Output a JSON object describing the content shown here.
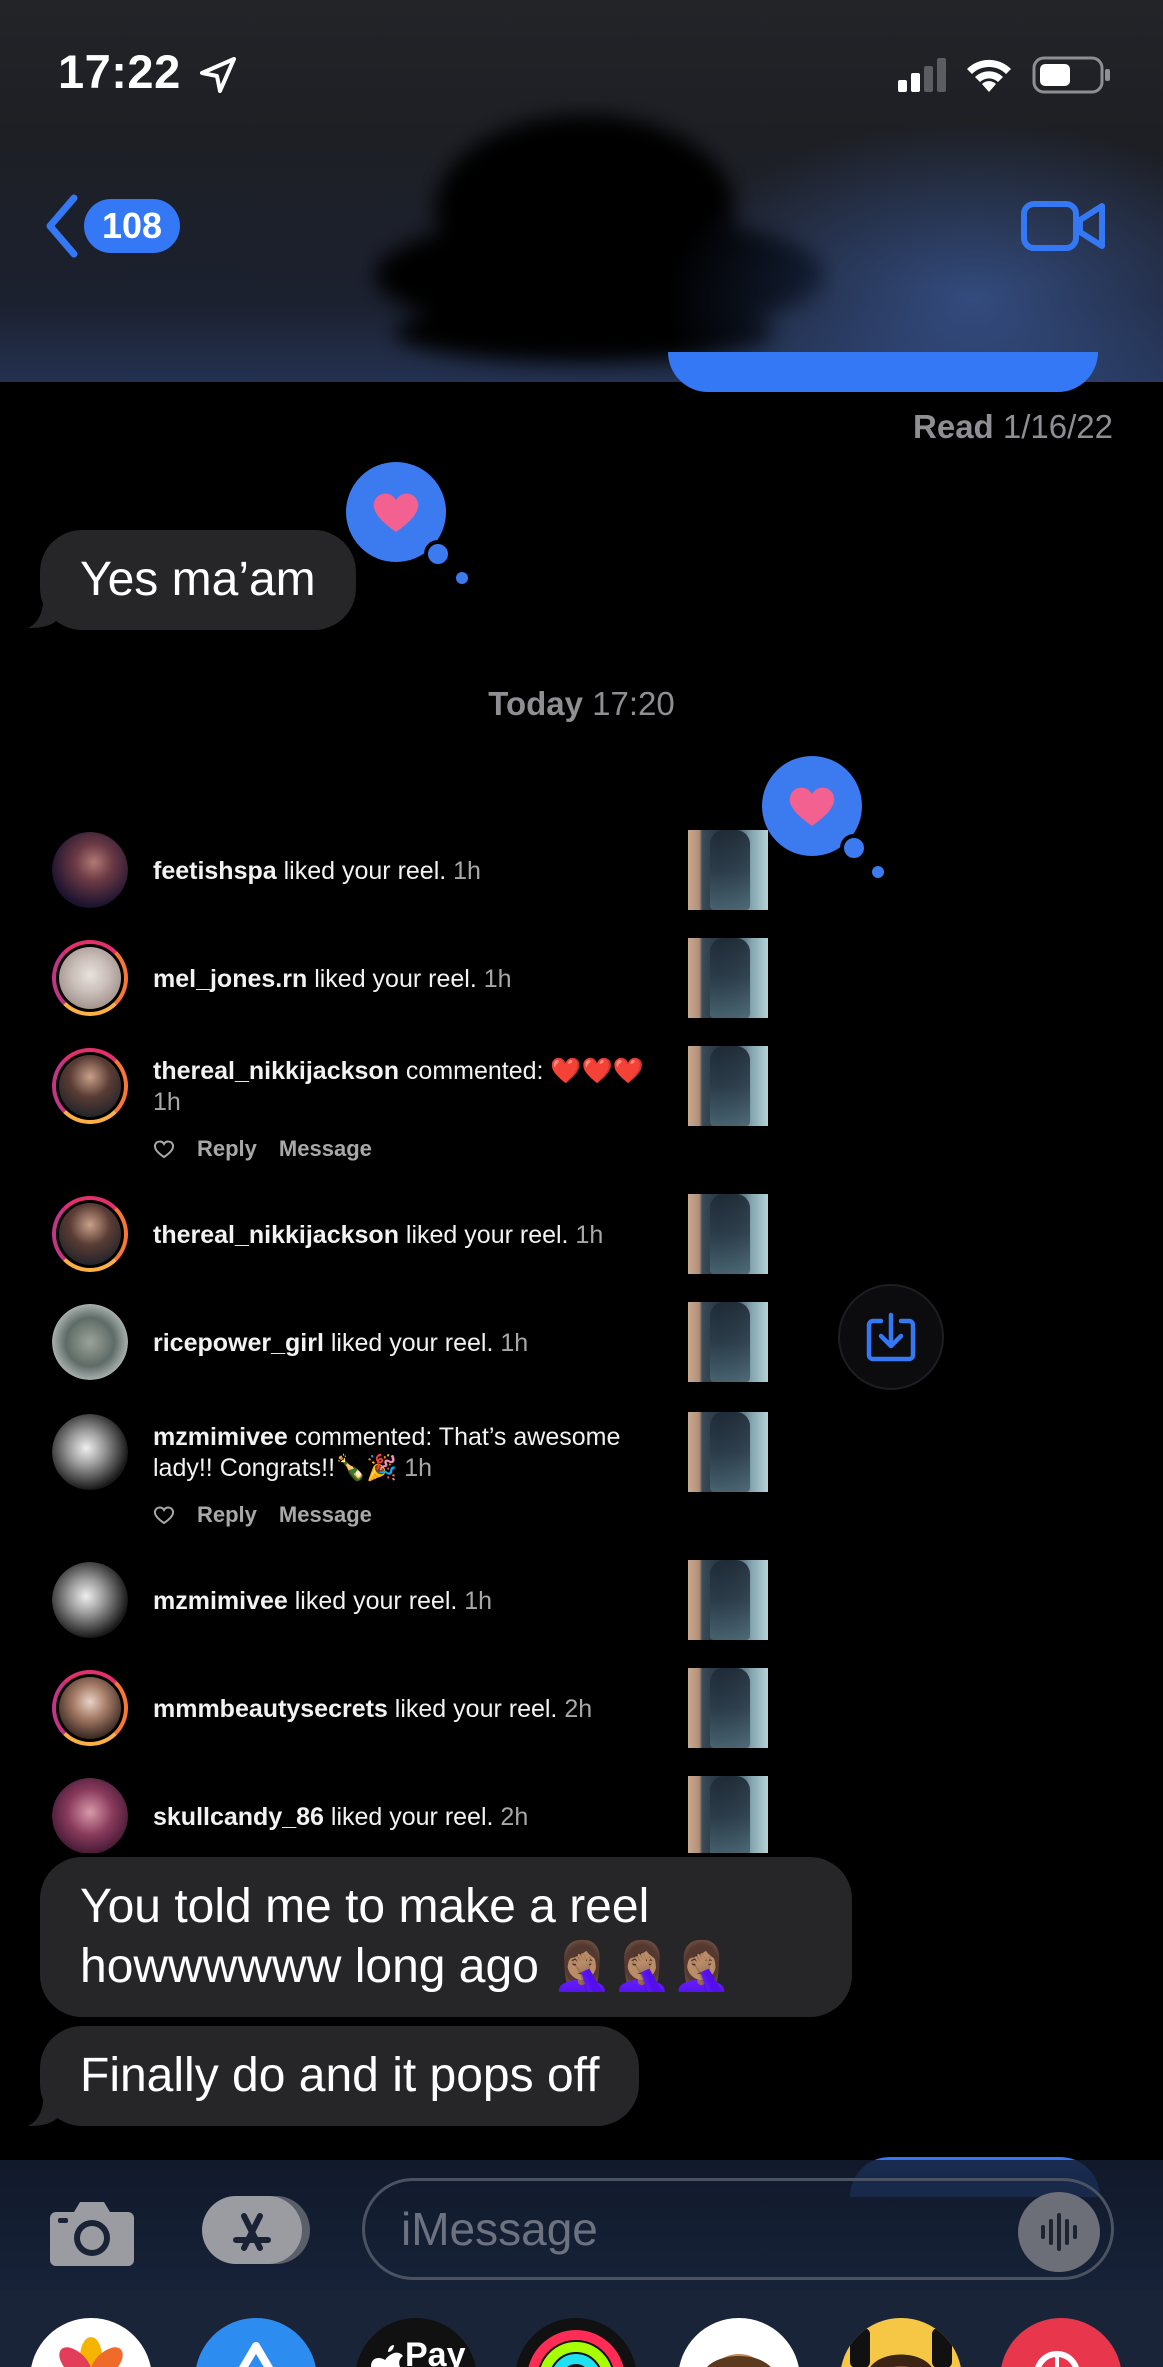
{
  "status_bar": {
    "time": "17:22",
    "icons": [
      "location-arrow-icon",
      "cellular-signal-icon",
      "wifi-icon",
      "battery-icon"
    ]
  },
  "header": {
    "back_count": "108",
    "icons": [
      "chevron-left-icon",
      "video-camera-icon"
    ]
  },
  "thread": {
    "read_receipt_label": "Read",
    "read_receipt_date": "1/16/22",
    "message_1": "Yes ma’am",
    "timestamp_day": "Today",
    "timestamp_time": "17:20",
    "message_2": "You told me to make a reel howwwwww long ago 🤦🏽‍♀️🤦🏽‍♀️🤦🏽‍♀️",
    "message_3": "Finally do and it pops off",
    "reaction": "heart"
  },
  "attachment": {
    "notifications": [
      {
        "user": "feetishspa",
        "action": "liked your reel.",
        "time": "1h"
      },
      {
        "user": "mel_jones.rn",
        "action": "liked your reel.",
        "time": "1h"
      },
      {
        "user": "thereal_nikkijackson",
        "action": "commented: ❤️❤️❤️",
        "time": "1h"
      },
      {
        "user": "thereal_nikkijackson",
        "action": "liked your reel.",
        "time": "1h"
      },
      {
        "user": "ricepower_girl",
        "action": "liked your reel.",
        "time": "1h"
      },
      {
        "user": "mzmimivee",
        "action": "commented: That’s awesome lady!! Congrats!!🍾🎉",
        "time": "1h"
      },
      {
        "user": "mzmimivee",
        "action": "liked your reel.",
        "time": "1h"
      },
      {
        "user": "mmmbeautysecrets",
        "action": "liked your reel.",
        "time": "2h"
      },
      {
        "user": "skullcandy_86",
        "action": "liked your reel.",
        "time": "2h"
      }
    ],
    "reply_label": "Reply",
    "message_label": "Message"
  },
  "input_bar": {
    "placeholder": "iMessage"
  },
  "app_strip": {
    "apps": [
      "photos-app-icon",
      "app-store-icon",
      "apple-pay-icon",
      "fitness-icon",
      "memoji-icon",
      "memoji-stickers-icon",
      "search-images-icon"
    ],
    "apple_pay_label": "Pay"
  },
  "colors": {
    "imessage_blue": "#3478f6",
    "received_bubble": "#262628",
    "heart_pink": "#f2618f"
  }
}
